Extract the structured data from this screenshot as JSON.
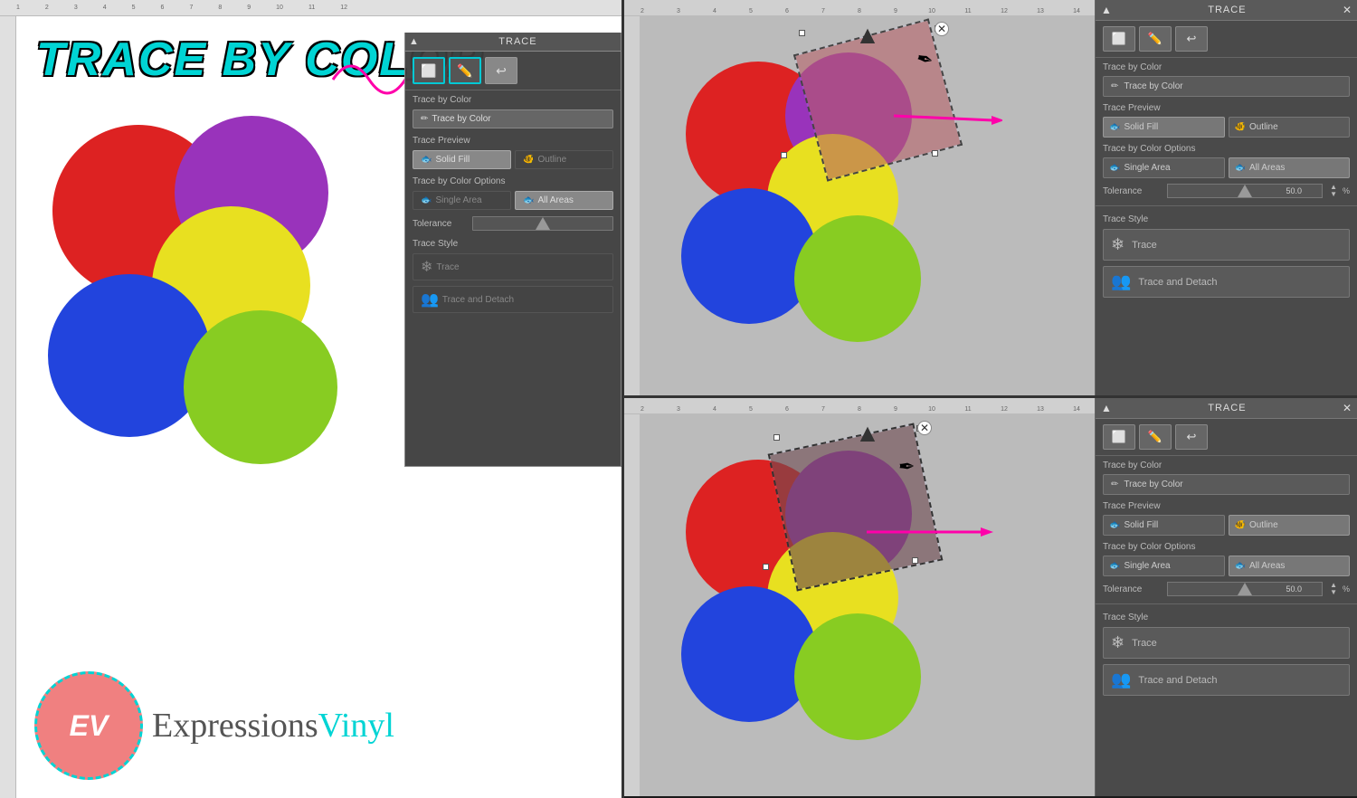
{
  "left": {
    "title_main": "TRACE BY COLOR",
    "logo": {
      "initials": "EV",
      "brand": "Expressions",
      "brand2": "Vinyl"
    },
    "trace_panel": {
      "header": "TRACE",
      "tab1": "⬜",
      "tab2": "✏",
      "tab3": "↩",
      "section1": "Trace by Color",
      "btn_trace_color": "Trace by Color",
      "section2": "Trace Preview",
      "btn_solid_fill": "Solid Fill",
      "btn_outline": "Outline",
      "section3": "Trace by Color Options",
      "btn_single": "Single Area",
      "btn_all": "All Areas",
      "section4": "Tolerance",
      "section5": "Trace Style",
      "btn_trace": "Trace",
      "btn_trace_detach": "Trace and Detach"
    }
  },
  "top_right": {
    "trace_panel": {
      "header": "TRACE",
      "section_tbc": "Trace by Color",
      "btn_tbc": "Trace by Color",
      "section_preview": "Trace Preview",
      "btn_solid": "Solid Fill",
      "btn_outline": "Outline",
      "section_options": "Trace by Color Options",
      "btn_single": "Single Area",
      "btn_all": "All Areas",
      "section_tolerance": "Tolerance",
      "tolerance_value": "50.0",
      "tolerance_pct": "%",
      "section_style": "Trace Style",
      "btn_trace": "Trace",
      "btn_trace_detach": "Trace and Detach",
      "active_preview": "solid"
    }
  },
  "bottom_right": {
    "trace_panel": {
      "header": "TRACE",
      "section_tbc": "Trace by Color",
      "btn_tbc": "Trace by Color",
      "section_preview": "Trace Preview",
      "btn_solid": "Solid Fill",
      "btn_outline": "Outline",
      "section_options": "Trace by Color Options",
      "btn_single": "Single Area",
      "btn_all": "All Areas",
      "section_tolerance": "Tolerance",
      "tolerance_value": "50.0",
      "tolerance_pct": "%",
      "section_style": "Trace Style",
      "btn_trace": "Trace",
      "btn_trace_detach": "Trace and Detach",
      "active_preview": "outline"
    }
  },
  "rulers": {
    "ticks": [
      "1",
      "2",
      "3",
      "4",
      "5",
      "6",
      "7",
      "8",
      "9",
      "10",
      "11",
      "12",
      "13",
      "14"
    ]
  }
}
